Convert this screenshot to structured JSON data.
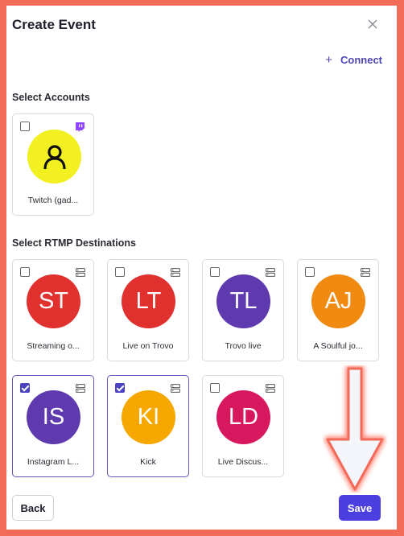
{
  "modal": {
    "title": "Create Event",
    "connect_label": "Connect"
  },
  "sections": {
    "accounts": "Select Accounts",
    "rtmp": "Select RTMP Destinations"
  },
  "accounts": [
    {
      "label": "Twitch (gad...",
      "checked": false,
      "platform": "twitch-icon",
      "avatar_color": "#f2f020"
    }
  ],
  "destinations": [
    {
      "initials": "ST",
      "label": "Streaming o...",
      "checked": false,
      "color": "#e0312e"
    },
    {
      "initials": "LT",
      "label": "Live on Trovo",
      "checked": false,
      "color": "#e0312e"
    },
    {
      "initials": "TL",
      "label": "Trovo live",
      "checked": false,
      "color": "#5e3aae"
    },
    {
      "initials": "AJ",
      "label": "A Soulful jo...",
      "checked": false,
      "color": "#f08a10"
    },
    {
      "initials": "IS",
      "label": "Instagram L...",
      "checked": true,
      "color": "#5e3aae"
    },
    {
      "initials": "KI",
      "label": "Kick",
      "checked": true,
      "color": "#f6a800"
    },
    {
      "initials": "LD",
      "label": "Live Discus...",
      "checked": false,
      "color": "#d8185e"
    }
  ],
  "footer": {
    "back_label": "Back",
    "save_label": "Save"
  },
  "colors": {
    "accent": "#4b3fe0",
    "connect": "#4f46b5",
    "frame": "#f26a58"
  }
}
